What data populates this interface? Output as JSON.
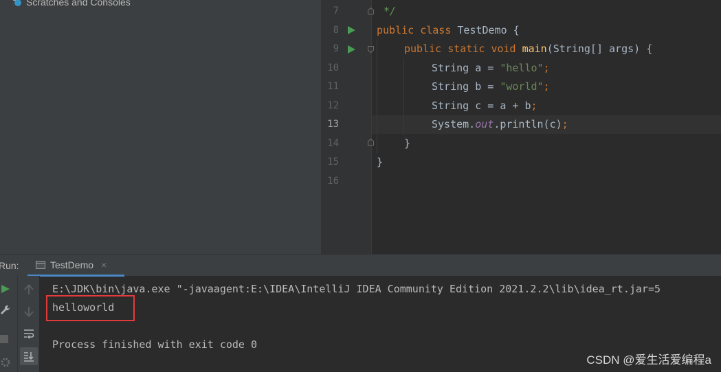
{
  "project_panel": {
    "scratches_label": "Scratches and Consoles"
  },
  "editor": {
    "lines": [
      {
        "num": "7"
      },
      {
        "num": "8"
      },
      {
        "num": "9"
      },
      {
        "num": "10"
      },
      {
        "num": "11"
      },
      {
        "num": "12"
      },
      {
        "num": "13"
      },
      {
        "num": "14"
      },
      {
        "num": "15"
      },
      {
        "num": "16"
      }
    ],
    "current_line": "13",
    "code": {
      "l7_comment": "*/",
      "l8_kw1": "public",
      "l8_kw2": "class",
      "l8_rest": "TestDemo {",
      "l9_kw1": "public",
      "l9_kw2": "static",
      "l9_kw3": "void",
      "l9_fn": "main",
      "l9_rest": "(String[] args) {",
      "l10_decl": "String a = ",
      "l10_str": "\"hello\"",
      "l10_end": ";",
      "l11_decl": "String b = ",
      "l11_str": "\"world\"",
      "l11_end": ";",
      "l12_code": "String c = a + b",
      "l12_end": ";",
      "l13_pre": "System.",
      "l13_field": "out",
      "l13_post": ".println(c)",
      "l13_end": ";",
      "l14_code": "}",
      "l15_code": "}"
    }
  },
  "run_panel": {
    "label": "Run:",
    "tab_title": "TestDemo",
    "tab_close": "×",
    "console_lines": [
      "E:\\JDK\\bin\\java.exe \"-javaagent:E:\\IDEA\\IntelliJ IDEA Community Edition 2021.2.2\\lib\\idea_rt.jar=5",
      "helloworld",
      "",
      "Process finished with exit code 0"
    ]
  },
  "watermark": "CSDN @爱生活爱编程a",
  "colors": {
    "keyword": "#cc7832",
    "string": "#6a8759",
    "function": "#ffc66d",
    "static_field": "#9876aa",
    "run_green": "#499c54",
    "highlight_red": "#e33b3b"
  }
}
